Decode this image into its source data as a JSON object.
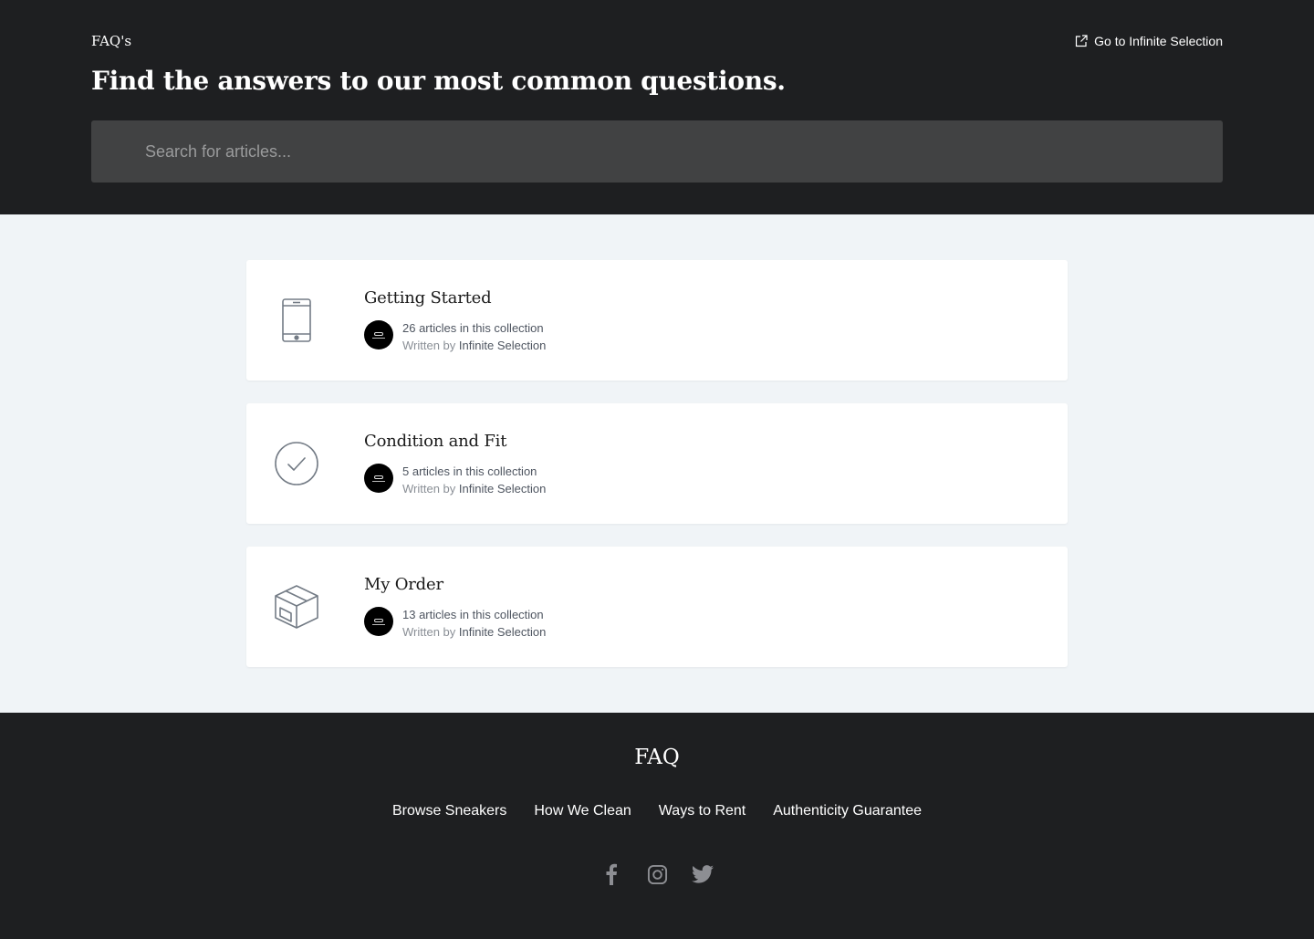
{
  "header": {
    "site_title": "FAQ's",
    "external_link": "Go to Infinite Selection",
    "headline": "Find the answers to our most common questions.",
    "search_placeholder": "Search for articles..."
  },
  "collections": [
    {
      "title": "Getting Started",
      "count": "26 articles in this collection",
      "written_by": "Written by",
      "author": "Infinite Selection",
      "icon": "phone-icon"
    },
    {
      "title": "Condition and Fit",
      "count": "5 articles in this collection",
      "written_by": "Written by",
      "author": "Infinite Selection",
      "icon": "check-circle-icon"
    },
    {
      "title": "My Order",
      "count": "13 articles in this collection",
      "written_by": "Written by",
      "author": "Infinite Selection",
      "icon": "package-box-icon"
    }
  ],
  "footer": {
    "title": "FAQ",
    "links": [
      "Browse Sneakers",
      "How We Clean",
      "Ways to Rent",
      "Authenticity Guarantee"
    ],
    "social": [
      "facebook-icon",
      "instagram-icon",
      "twitter-icon"
    ]
  },
  "colors": {
    "dark_bg": "#1e1f21",
    "search_bg": "#414243",
    "page_bg": "#f0f4f7",
    "card_bg": "#ffffff",
    "icon_gray": "#737b85",
    "social_gray": "#8d8e93"
  }
}
